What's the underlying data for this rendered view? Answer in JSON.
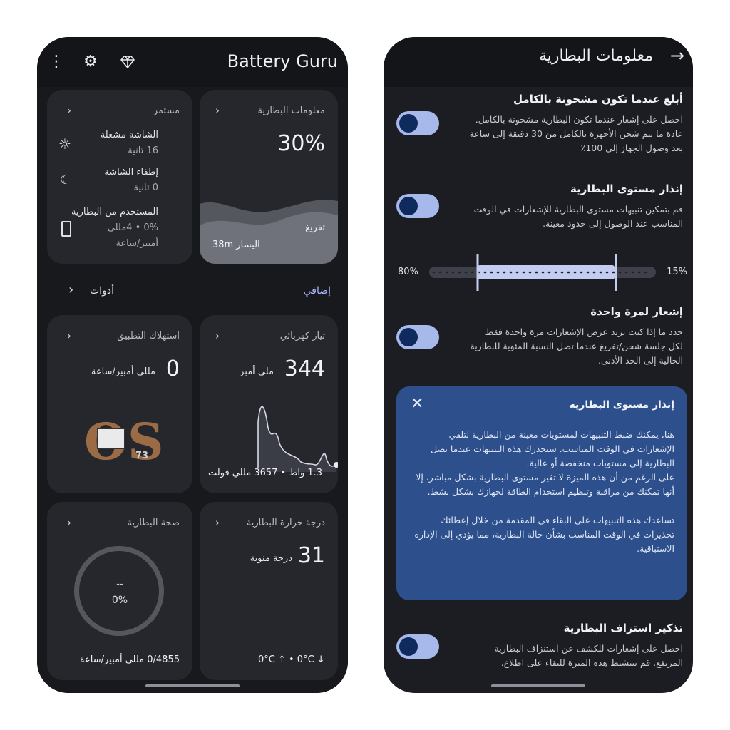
{
  "left": {
    "app_title": "Battery Guru",
    "battery_info": {
      "title": "معلومات البطارية",
      "percent": "30%",
      "state": "تفريغ",
      "remaining": "اليسار 38m"
    },
    "ongoing": {
      "title": "مستمر",
      "screen_on_label": "الشاشة مشغلة",
      "screen_on_value": "16 ثانية",
      "screen_off_label": "إطفاء الشاشة",
      "screen_off_value": "0 ثانية",
      "used_label": "المستخدم من البطارية",
      "used_value": "0% • 4مللي",
      "used_unit": "أمبير/ساعة"
    },
    "extra_label": "إضافي",
    "tools_label": "أدوات",
    "current": {
      "title": "تيار كهربائي",
      "value": "344",
      "unit": "ملي أمبر",
      "footer": "1.3 واط • 3657 مللي فولت"
    },
    "app_usage": {
      "title": "استهلاك التطبيق",
      "value": "0",
      "unit": "مللي أمبير/ساعة",
      "logo_text": "OS",
      "logo_num": "73"
    },
    "temperature": {
      "title": "درجة حرارة البطارية",
      "value": "31",
      "unit": "درجة منوية",
      "footer": "0°C ↑ • 0°C ↓"
    },
    "health": {
      "title": "صحة البطارية",
      "dash": "--",
      "percent": "0%",
      "footer": "0/4855 مللي أمبير/ساعة"
    }
  },
  "right": {
    "title": "معلومات البطارية",
    "full_title": "أبلغ عندما تكون مشحونة بالكامل",
    "full_desc": "احصل على إشعار عندما تكون البطارية مشحونة بالكامل. عادة ما يتم شحن الأجهزة بالكامل من 30 دقيقة إلى ساعة بعد وصول الجهاز إلى 100٪",
    "alarm_title": "إنذار مستوى البطارية",
    "alarm_desc": "قم بتمكين تنبيهات مستوى البطارية للإشعارات في الوقت المناسب عند الوصول إلى حدود معينة.",
    "range": {
      "low_label": "15%",
      "high_label": "80%",
      "low": 15,
      "high": 80
    },
    "once_title": "إشعار لمرة واحدة",
    "once_desc": "حدد ما إذا كنت تريد عرض الإشعارات مرة واحدة فقط لكل جلسة شحن/تفريغ عندما تصل النسبة المئوية للبطارية الحالية إلى الحد الأدنى.",
    "info_title": "إنذار مستوى البطارية",
    "info_text": "هنا، يمكنك ضبط التنبيهات لمستويات معينة من البطارية لتلقي الإشعارات في الوقت المناسب. ستحذرك هذه التنبيهات عندما تصل البطارية إلى مستويات منخفضة أو عالية.\nعلى الرغم من أن هذه الميزة لا تغير مستوى البطارية بشكل مباشر، إلا أنها تمكنك من مراقبة وتنظيم استخدام الطاقة لجهازك بشكل نشط.\n\nتساعدك هذه التنبيهات على البقاء في المقدمة من خلال إعطائك تحذيرات في الوقت المناسب بشأن حالة البطارية، مما يؤدي إلى الإدارة الاستباقية.",
    "drain_title": "تذكير استزاف البطارية",
    "drain_desc": "احصل على إشعارات للكشف عن استنزاف البطارية المرتفع. قم بتنشيط هذه الميزة للبقاء على اطلاع."
  }
}
